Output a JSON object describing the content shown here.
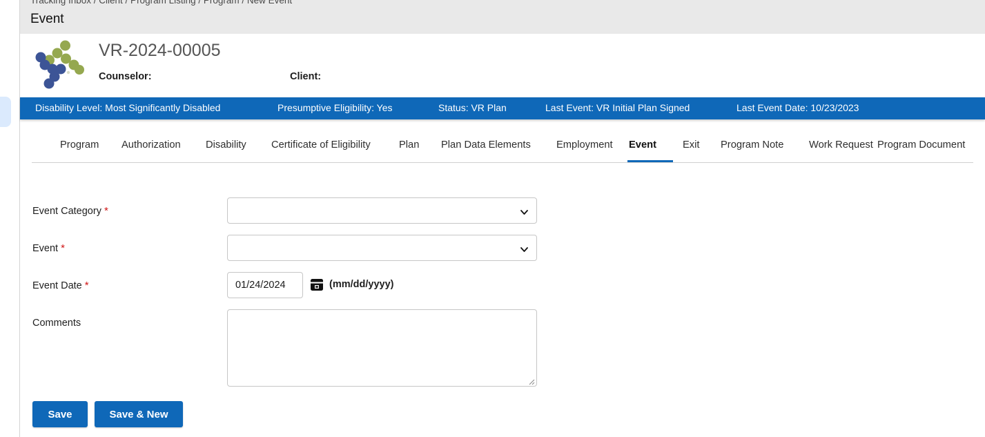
{
  "theme": {
    "accent_blue": "#0f68b8",
    "required_red": "#d01515",
    "band_gray": "#e9e9e9",
    "logo_blue": "#3c5496",
    "logo_green": "#95a84f"
  },
  "breadcrumb": {
    "text": "Tracking Inbox / Client / Program Listing / Program / New Event"
  },
  "page": {
    "title": "Event"
  },
  "record": {
    "id": "VR-2024-00005",
    "counselor_label": "Counselor:",
    "client_label": "Client:",
    "logo_name": "agency-dots-logo"
  },
  "statusbar": {
    "items": [
      {
        "text": "Disability Level: Most Significantly Disabled",
        "name": "status-disability-level"
      },
      {
        "text": "Presumptive Eligibility: Yes",
        "name": "status-presumptive-eligibility"
      },
      {
        "text": "Status: VR Plan",
        "name": "status-status"
      },
      {
        "text": "Last Event: VR Initial Plan Signed",
        "name": "status-last-event"
      },
      {
        "text": "Last Event Date: 10/23/2023",
        "name": "status-last-event-date"
      }
    ]
  },
  "tabs": {
    "items": [
      {
        "label": "Program",
        "active": false
      },
      {
        "label": "Authorization",
        "active": false
      },
      {
        "label": "Disability",
        "active": false
      },
      {
        "label": "Certificate of Eligibility",
        "active": false
      },
      {
        "label": "Plan",
        "active": false
      },
      {
        "label": "Plan Data Elements",
        "active": false
      },
      {
        "label": "Employment",
        "active": false
      },
      {
        "label": "Event",
        "active": true
      },
      {
        "label": "Exit",
        "active": false
      },
      {
        "label": "Program Note",
        "active": false
      },
      {
        "label": "Work Request",
        "active": false
      },
      {
        "label": "Program Document",
        "active": false
      }
    ]
  },
  "form": {
    "event_category": {
      "label": "Event Category",
      "required_marker": "*",
      "value": "",
      "selected_option": ""
    },
    "event": {
      "label": "Event",
      "required_marker": "*",
      "value": "",
      "selected_option": ""
    },
    "event_date": {
      "label": "Event Date",
      "required_marker": "*",
      "value": "01/24/2024",
      "format_hint": "(mm/dd/yyyy)",
      "calendar_icon": "calendar-icon"
    },
    "comments": {
      "label": "Comments",
      "value": "",
      "placeholder": ""
    }
  },
  "actions": {
    "save": "Save",
    "save_and_new": "Save & New"
  }
}
